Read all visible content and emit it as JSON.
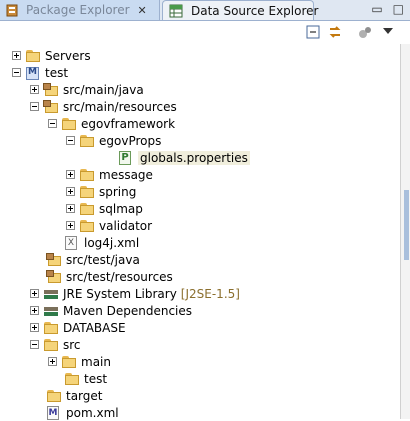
{
  "tabs": {
    "package_explorer": "Package Explorer",
    "data_source_explorer": "Data Source Explorer",
    "close_glyph": "✕"
  },
  "window_controls": {
    "minimize": "▭",
    "maximize": "□"
  },
  "toolbar": {
    "icons": [
      "collapse-all-icon",
      "link-with-editor-icon",
      "filters-icon",
      "view-menu-icon"
    ]
  },
  "tree": {
    "servers": "Servers",
    "test": "test",
    "src_main_java": "src/main/java",
    "src_main_resources": "src/main/resources",
    "egovframework": "egovframework",
    "egovprops": "egovProps",
    "globals_properties": "globals.properties",
    "message": "message",
    "spring": "spring",
    "sqlmap": "sqlmap",
    "validator": "validator",
    "log4j": "log4j.xml",
    "src_test_java": "src/test/java",
    "src_test_resources": "src/test/resources",
    "jre_library": "JRE System Library",
    "jre_version": "[J2SE-1.5]",
    "maven_deps": "Maven Dependencies",
    "database": "DATABASE",
    "src": "src",
    "main": "main",
    "test_folder": "test",
    "target": "target",
    "pom": "pom.xml"
  }
}
